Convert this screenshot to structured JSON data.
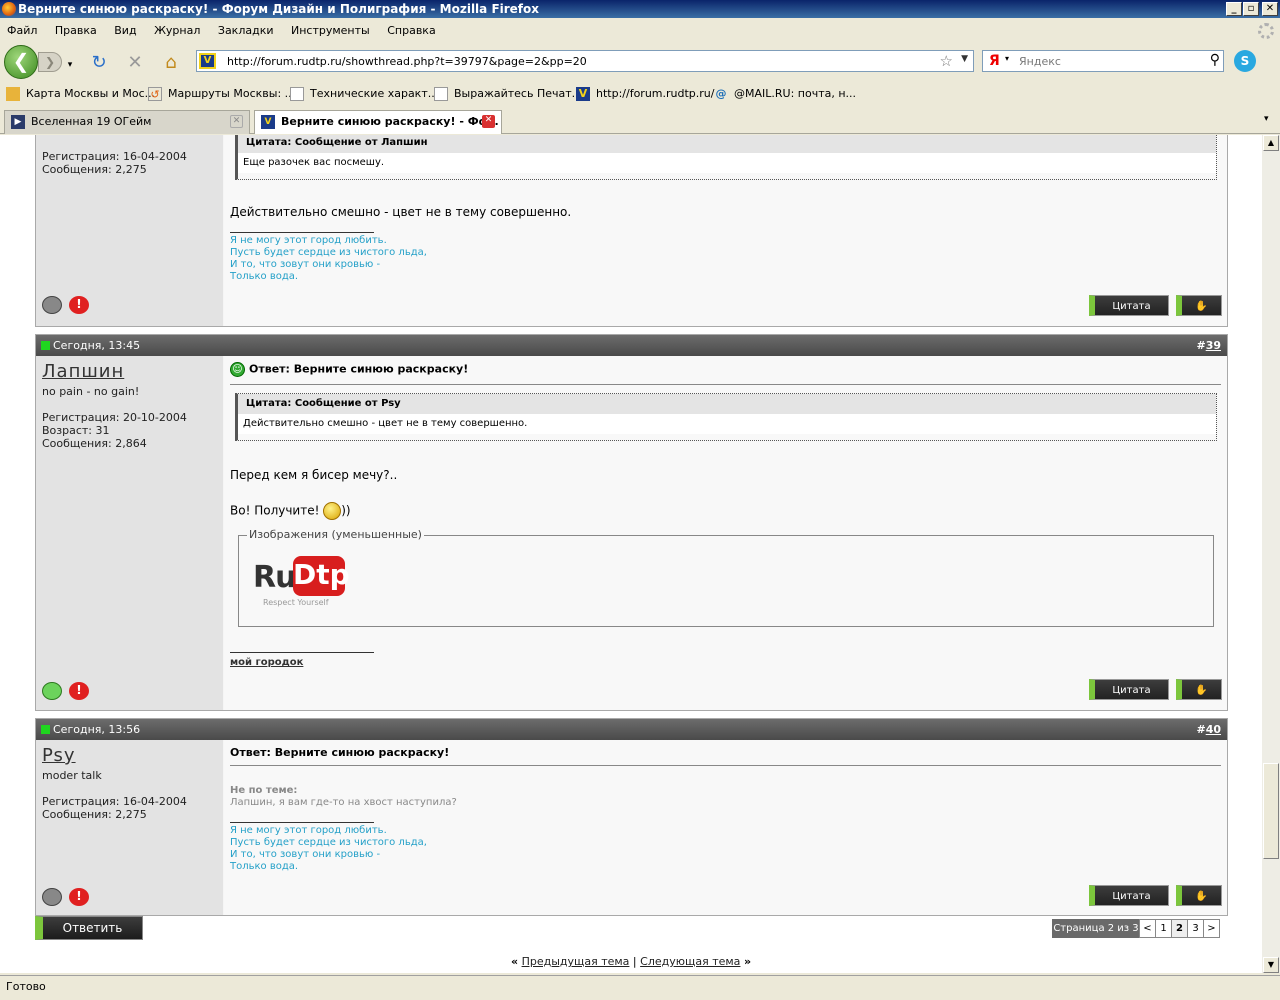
{
  "window": {
    "title": "Верните синюю раскраску! - Форум Дизайн и Полиграфия - Mozilla Firefox",
    "min": "_",
    "max": "▫",
    "close": "✕"
  },
  "menu": [
    "Файл",
    "Правка",
    "Вид",
    "Журнал",
    "Закладки",
    "Инструменты",
    "Справка"
  ],
  "nav": {
    "url": "http://forum.rudtp.ru/showthread.php?t=39797&page=2&pp=20",
    "search_placeholder": "Яндекс",
    "search_engine": "Я"
  },
  "bookmarks": [
    "Карта Москвы и Мос...",
    "Маршруты Москвы: ...",
    "Технические характ...",
    "Выражайтесь Печат...",
    "http://forum.rudtp.ru/",
    "@MAIL.RU: почта, н..."
  ],
  "tabs": [
    {
      "label": "Вселенная 19 ОГейм"
    },
    {
      "label": "Верните синюю раскраску! - Фо..."
    }
  ],
  "posts": [
    {
      "user_stats": [
        "Регистрация: 16-04-2004",
        "Сообщения: 2,275"
      ],
      "quote_head": "Цитата: Сообщение от Лапшин",
      "quote_body": "Еще разочек вас посмешу.",
      "text": "Действительно смешно - цвет не в тему совершенно.",
      "sig": [
        "Я не могу этот город любить.",
        "Пусть будет сердце из чистого льда,",
        "И то, что зовут они кровью -",
        "Только вода."
      ],
      "quote_btn": "Цитата"
    },
    {
      "date": "Сегодня, 13:45",
      "hash": "#",
      "num": "39",
      "username": "Лапшин",
      "usertitle": "no pain - no gain!",
      "user_stats": [
        "Регистрация: 20-10-2004",
        "Возраст: 31",
        "Сообщения: 2,864"
      ],
      "title": "Ответ: Верните синюю раскраску!",
      "quote_head": "Цитата: Сообщение от Psy",
      "quote_body": "Действительно смешно - цвет не в тему совершенно.",
      "text1": "Перед кем я бисер мечу?..",
      "text2": "Во! Получите!",
      "text2_after": "))",
      "images_legend": "Изображения (уменьшенные)",
      "logo_ru": "Ru",
      "logo_dtp": "Dtp",
      "logo_tagline": "Respect Yourself",
      "sig_link": "мой городок",
      "quote_btn": "Цитата"
    },
    {
      "date": "Сегодня, 13:56",
      "hash": "#",
      "num": "40",
      "username": "Psy",
      "usertitle": "moder talk",
      "user_stats": [
        "Регистрация: 16-04-2004",
        "Сообщения: 2,275"
      ],
      "title": "Ответ: Верните синюю раскраску!",
      "offtopic_label": "Не по теме:",
      "offtopic_text": "Лапшин, я вам где-то на хвост наступила?",
      "sig": [
        "Я не могу этот город любить.",
        "Пусть будет сердце из чистого льда,",
        "И то, что зовут они кровью -",
        "Только вода."
      ],
      "quote_btn": "Цитата"
    }
  ],
  "reply_btn": "Ответить",
  "pager": {
    "label": "Страница 2 из 3",
    "prev": "<",
    "pages": [
      "1",
      "2",
      "3"
    ],
    "current": "2",
    "next": ">"
  },
  "threadnav": {
    "prev_arrows": "«",
    "prev": "Предыдущая тема",
    "sep": "|",
    "next": "Следующая тема",
    "next_arrows": "»"
  },
  "status": "Готово"
}
